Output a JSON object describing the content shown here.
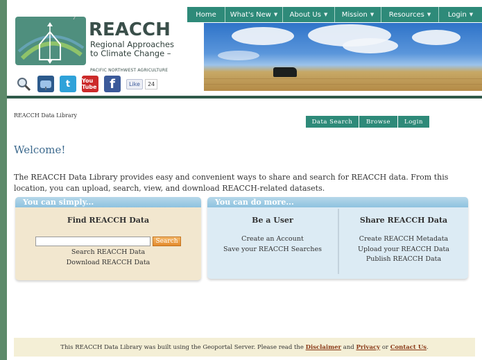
{
  "logo": {
    "title": "REACCH",
    "subtitle_line1": "Regional Approaches",
    "subtitle_line2": "to Climate Change –",
    "tagline": "PACIFIC NORTHWEST AGRICULTURE"
  },
  "social": {
    "search_icon": "magnifier-icon",
    "mail_icon": "mailbox-icon",
    "twitter_icon": "twitter-icon",
    "twitter_glyph": "t",
    "youtube_glyph": "You Tube",
    "facebook_glyph": "f",
    "like_label": "Like",
    "like_count": "24"
  },
  "nav": {
    "items": [
      {
        "label": "Home",
        "dropdown": false
      },
      {
        "label": "What's New",
        "dropdown": true
      },
      {
        "label": "About Us",
        "dropdown": true
      },
      {
        "label": "Mission",
        "dropdown": true
      },
      {
        "label": "Resources",
        "dropdown": true
      },
      {
        "label": "Login",
        "dropdown": true
      }
    ],
    "caret": "▼"
  },
  "breadcrumb": "REACCH Data Library",
  "subnav": {
    "data_search": "Data Search",
    "browse": "Browse",
    "login": "Login"
  },
  "welcome": "Welcome!",
  "intro": "The REACCH Data Library provides easy and convenient ways to share and search for REACCH data. From this location, you can upload, search, view, and download REACCH-related datasets.",
  "panel_left": {
    "header": "You can simply...",
    "title": "Find REACCH Data",
    "search_placeholder": "",
    "search_button": "Search",
    "links": [
      "Search REACCH Data",
      "Download REACCH Data"
    ]
  },
  "panel_right": {
    "header": "You can do more...",
    "user": {
      "title": "Be a User",
      "links": [
        "Create an Account",
        "Save your REACCH Searches"
      ]
    },
    "share": {
      "title": "Share REACCH Data",
      "links": [
        "Create REACCH Metadata",
        "Upload your REACCH Data",
        "Publish REACCH Data"
      ]
    }
  },
  "footer": {
    "text_prefix": "This REACCH Data Library was built using the Geoportal Server. Please read the",
    "disclaimer": "Disclaimer",
    "and": "and",
    "privacy": "Privacy",
    "or": "or",
    "contact": "Contact Us",
    "end": "."
  },
  "colors": {
    "nav_bg": "#2e8a79",
    "header_rule": "#2f5a4a",
    "panel_left_bg": "#f2e7cf",
    "panel_right_bg": "#dcebf4",
    "search_button": "#e38a2d",
    "welcome_text": "#3d6a8e"
  }
}
